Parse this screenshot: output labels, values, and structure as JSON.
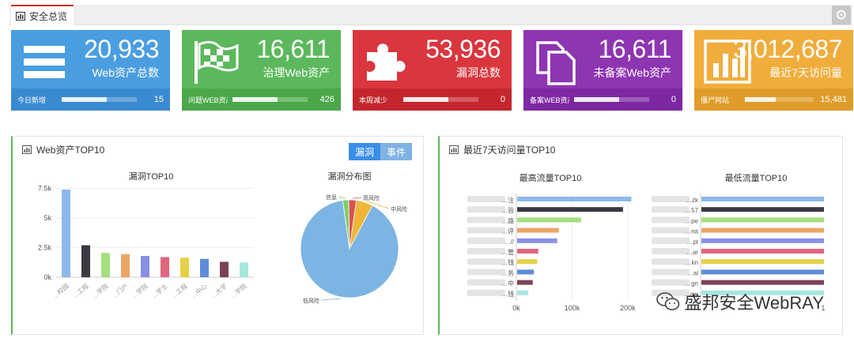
{
  "header": {
    "tab_label": "安全总览"
  },
  "cards": [
    {
      "value": "20,933",
      "label": "Web资产总数",
      "foot_label": "今日新增",
      "foot_value": "15",
      "progress": 0.6,
      "color": "#4a9ee0",
      "foot_color": "#3a8ad0",
      "icon": "menu-icon"
    },
    {
      "value": "16,611",
      "label": "治理Web资产",
      "foot_label": "问题WEB资产",
      "foot_value": "426",
      "progress": 0.6,
      "color": "#5cb85c",
      "foot_color": "#4aa84a",
      "icon": "flag-icon"
    },
    {
      "value": "53,936",
      "label": "漏洞总数",
      "foot_label": "本周减少",
      "foot_value": "0",
      "progress": 0.6,
      "color": "#d9363e",
      "foot_color": "#c4262e",
      "icon": "puzzle-icon"
    },
    {
      "value": "16,611",
      "label": "未备案Web资产",
      "foot_label": "备案WEB资产",
      "foot_value": "0",
      "progress": 0.6,
      "color": "#8e35b2",
      "foot_color": "#7d27a2",
      "icon": "copy-icon"
    },
    {
      "value": "3,012,687",
      "label": "最近7天访问量",
      "foot_label": "僵尸网站",
      "foot_value": "15,481",
      "progress": 0.45,
      "color": "#f0ad3c",
      "foot_color": "#e09c2a",
      "icon": "bar-chart-icon"
    }
  ],
  "left_panel": {
    "title": "Web资产TOP10",
    "toggle": {
      "active": "漏洞",
      "inactive": "事件"
    }
  },
  "right_panel": {
    "title": "最近7天访问量TOP10"
  },
  "watermark": "盛邦安全WebRAY",
  "chart_data": [
    {
      "type": "bar",
      "title": "漏洞TOP10",
      "categories": [
        "…校园",
        "…工程",
        "…学院",
        "…门户",
        "…学院",
        "…学士",
        "…工程",
        "…中心",
        "…大学",
        "…学院"
      ],
      "values": [
        7400,
        2700,
        2050,
        1950,
        1800,
        1700,
        1650,
        1550,
        1300,
        1250
      ],
      "ylim": [
        0,
        8000
      ],
      "yticks": [
        "0k",
        "2.5k",
        "5k",
        "7.5k"
      ],
      "colors": [
        "#8cb8ea",
        "#3a3a42",
        "#a4e07e",
        "#eba667",
        "#8a8fe6",
        "#e1667f",
        "#e6d04a",
        "#5e8bd8",
        "#7a4257",
        "#a6e6df"
      ]
    },
    {
      "type": "pie",
      "title": "漏洞分布图",
      "slices": [
        {
          "label": "低风险",
          "value": 90.0,
          "color": "#7cb5e3"
        },
        {
          "label": "中风险",
          "value": 5.5,
          "color": "#f0b63a"
        },
        {
          "label": "高风险",
          "value": 2.5,
          "color": "#d9534f"
        },
        {
          "label": "信息",
          "value": 2.0,
          "color": "#7ed06a"
        }
      ]
    },
    {
      "type": "bar",
      "orientation": "horizontal",
      "title": "最高流量TOP10",
      "categories": [
        "…注",
        "…验",
        "…路",
        "…评",
        "…//",
        "…管",
        "…钱",
        "…务",
        "…中",
        "…钱"
      ],
      "values": [
        205000,
        190000,
        115000,
        75000,
        72000,
        38000,
        36000,
        30000,
        28000,
        20000
      ],
      "xlim": [
        0,
        220000
      ],
      "xticks": [
        "0k",
        "100k",
        "200k"
      ],
      "colors": [
        "#8cb8ea",
        "#3a3a42",
        "#a4e07e",
        "#eba667",
        "#8a8fe6",
        "#e1667f",
        "#e6d04a",
        "#5e8bd8",
        "#7a4257",
        "#a6e6df"
      ]
    },
    {
      "type": "bar",
      "orientation": "horizontal",
      "title": "最低流量TOP10",
      "categories": [
        "…zk",
        "…57",
        "…pe",
        "…na",
        "…pt",
        "…ar",
        "…kn",
        "…al",
        "…gn",
        "…aw"
      ],
      "values": [
        1,
        1,
        1,
        1,
        1,
        1,
        1,
        1,
        1,
        1
      ],
      "xlim": [
        0,
        1
      ],
      "xticks": [
        "1"
      ],
      "colors": [
        "#8cb8ea",
        "#3a3a42",
        "#a4e07e",
        "#eba667",
        "#8a8fe6",
        "#e1667f",
        "#e6d04a",
        "#5e8bd8",
        "#7a4257",
        "#a6e6df"
      ]
    }
  ]
}
